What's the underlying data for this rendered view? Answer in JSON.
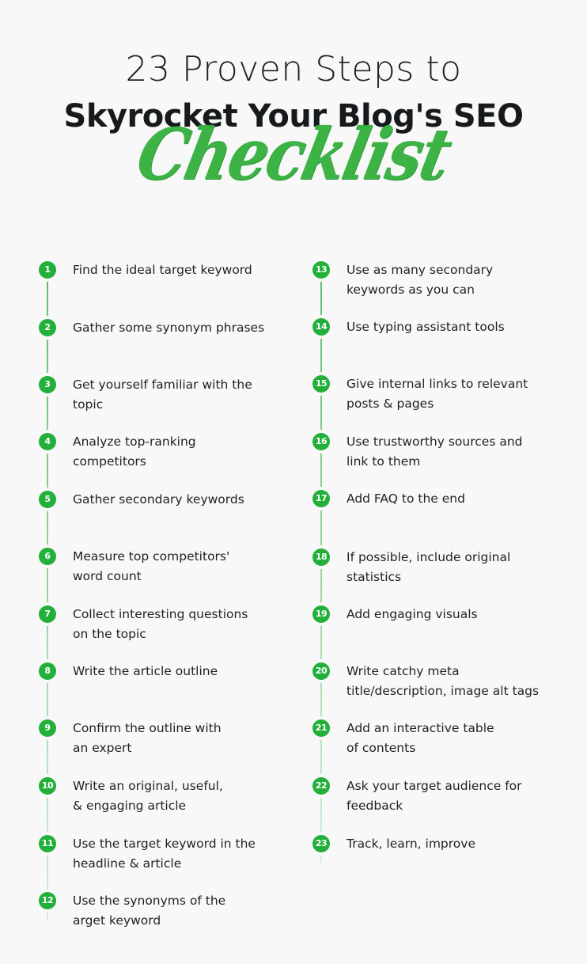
{
  "header": {
    "line1": "23 Proven Steps to",
    "line2": "Skyrocket Your Blog's SEO",
    "script": "Checklist"
  },
  "colors": {
    "accent": "#22b03a",
    "connector_top": "#5cbf6c",
    "connector_bottom": "#d9efdc",
    "text": "#1e2123",
    "background": "#f8f8f8"
  },
  "steps": [
    {
      "number": "1",
      "lines": [
        "Find the ideal target keyword"
      ]
    },
    {
      "number": "2",
      "lines": [
        "Gather some synonym phrases"
      ]
    },
    {
      "number": "3",
      "lines": [
        "Get yourself familiar with the",
        "topic"
      ]
    },
    {
      "number": "4",
      "lines": [
        "Analyze top-ranking",
        "competitors"
      ]
    },
    {
      "number": "5",
      "lines": [
        "Gather secondary keywords"
      ]
    },
    {
      "number": "6",
      "lines": [
        "Measure top competitors'",
        "word count"
      ]
    },
    {
      "number": "7",
      "lines": [
        "Collect interesting questions",
        "on the topic"
      ]
    },
    {
      "number": "8",
      "lines": [
        "Write the article outline"
      ]
    },
    {
      "number": "9",
      "lines": [
        "Confirm the outline with",
        "an expert"
      ]
    },
    {
      "number": "10",
      "lines": [
        "Write an original, useful,",
        "& engaging article"
      ]
    },
    {
      "number": "11",
      "lines": [
        "Use the target keyword in the",
        "headline & article"
      ]
    },
    {
      "number": "12",
      "lines": [
        "Use the synonyms of the",
        "arget keyword"
      ]
    },
    {
      "number": "13",
      "lines": [
        "Use as many secondary",
        "keywords as you can"
      ]
    },
    {
      "number": "14",
      "lines": [
        "Use typing assistant tools"
      ]
    },
    {
      "number": "15",
      "lines": [
        "Give internal links to relevant",
        "posts & pages"
      ]
    },
    {
      "number": "16",
      "lines": [
        "Use trustworthy sources and",
        "link to them"
      ]
    },
    {
      "number": "17",
      "lines": [
        "Add FAQ to the end"
      ]
    },
    {
      "number": "18",
      "lines": [
        "If possible, include original",
        "statistics"
      ]
    },
    {
      "number": "19",
      "lines": [
        "Add engaging visuals"
      ]
    },
    {
      "number": "20",
      "lines": [
        "Write catchy meta",
        "title/description, image alt tags"
      ]
    },
    {
      "number": "21",
      "lines": [
        "Add an interactive table",
        "of contents"
      ]
    },
    {
      "number": "22",
      "lines": [
        "Ask your target audience for",
        "feedback"
      ]
    },
    {
      "number": "23",
      "lines": [
        "Track, learn, improve"
      ]
    }
  ]
}
